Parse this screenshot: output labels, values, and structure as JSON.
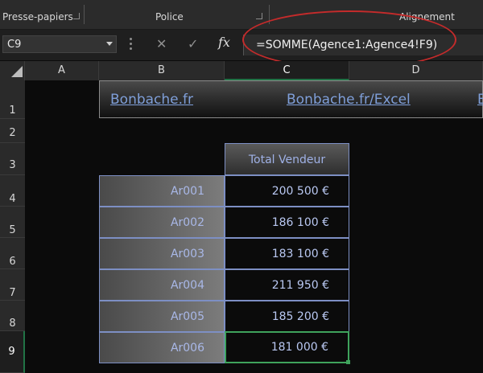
{
  "ribbon": {
    "groups": [
      "Presse-papiers",
      "Police",
      "Alignement"
    ]
  },
  "formula_bar": {
    "name_box": "C9",
    "cancel_icon": "close-icon",
    "enter_icon": "check-icon",
    "fx_label": "fx",
    "formula": "=SOMME(Agence1:Agence4!F9)"
  },
  "columns": [
    "A",
    "B",
    "C",
    "D"
  ],
  "rows": [
    "1",
    "2",
    "3",
    "4",
    "5",
    "6",
    "7",
    "8",
    "9"
  ],
  "banner": {
    "links": [
      "Bonbache.fr",
      "Bonbache.fr/Excel",
      "B"
    ]
  },
  "table": {
    "header": "Total Vendeur",
    "rows": [
      {
        "agent": "Ar001",
        "total": "200 500 €"
      },
      {
        "agent": "Ar002",
        "total": "186 100 €"
      },
      {
        "agent": "Ar003",
        "total": "183 100 €"
      },
      {
        "agent": "Ar004",
        "total": "211 950 €"
      },
      {
        "agent": "Ar005",
        "total": "185 200 €"
      },
      {
        "agent": "Ar006",
        "total": "181 000 €"
      }
    ]
  },
  "colors": {
    "selection": "#217346",
    "annotation": "#c42b2b",
    "link": "#7f9fd9"
  }
}
